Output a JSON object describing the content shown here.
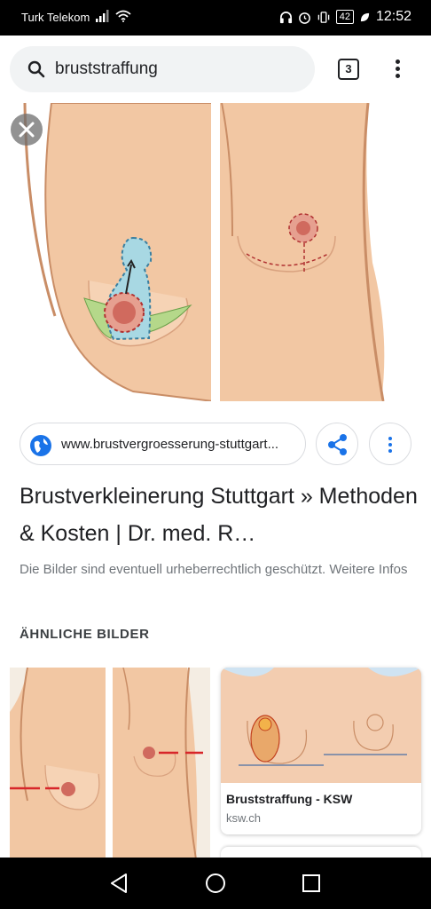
{
  "status_bar": {
    "carrier": "Turk Telekom",
    "battery": "42",
    "time": "12:52"
  },
  "search": {
    "query": "bruststraffung",
    "tab_count": "3"
  },
  "result": {
    "url": "www.brustvergroesserung-stuttgart...",
    "title": "Brustverkleinerung Stuttgart » Methoden & Kosten | Dr. med. R…",
    "notice": "Die Bilder sind eventuell urheberrechtlich geschützt. Weitere Infos"
  },
  "similar": {
    "heading": "ÄHNLICHE BILDER",
    "items": [
      {
        "caption": "",
        "domain": ""
      },
      {
        "caption": "Bruststraffung - KSW",
        "domain": "ksw.ch"
      }
    ]
  },
  "icons": {
    "search": "search-icon",
    "tabs": "tab-switcher-icon",
    "more": "more-vert-icon",
    "close": "close-icon",
    "globe": "globe-icon",
    "share": "share-icon",
    "back": "back-icon",
    "home": "home-icon",
    "recents": "recents-icon"
  },
  "colors": {
    "accent": "#1a73e8",
    "skin": "#f2c7a3",
    "marking_blue": "#a8d8e3",
    "marking_green": "#b5d88a",
    "areola": "#e08a7c"
  }
}
